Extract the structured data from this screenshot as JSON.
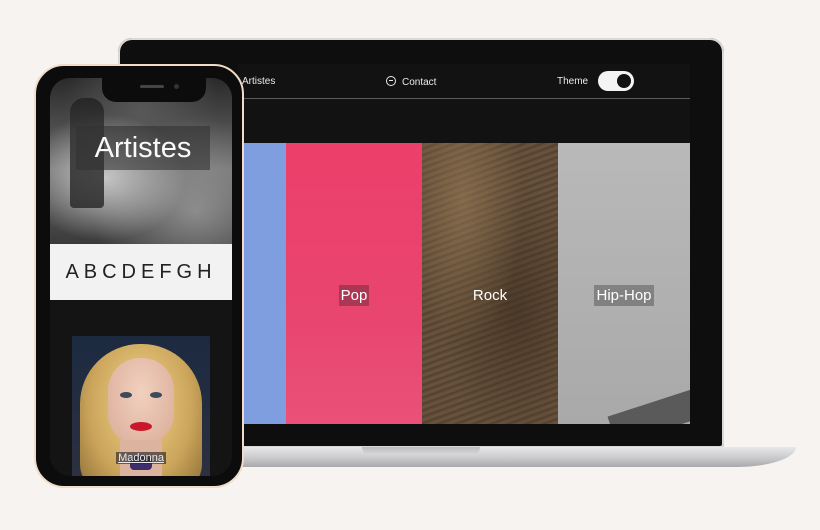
{
  "desktop": {
    "nav": {
      "artistes_label": "Artistes",
      "contact_label": "Contact",
      "theme_label": "Theme",
      "theme_toggle_on": true
    },
    "genres": [
      {
        "label": "",
        "color": "#7f9ee0"
      },
      {
        "label": "Pop",
        "color": "#e8456f"
      },
      {
        "label": "Rock",
        "color": "#5c4834"
      },
      {
        "label": "Hip-Hop",
        "color": "#aeaeae"
      }
    ]
  },
  "mobile": {
    "hero_title": "Artistes",
    "alphabet": "ABCDEFGH",
    "artist": {
      "name": "Madonna"
    }
  },
  "icons": {
    "contact": "chat-bubble-icon"
  },
  "colors": {
    "page_background": "#f7f3f0",
    "screen_background": "#121212",
    "phone_border": "#f0dcc8"
  }
}
